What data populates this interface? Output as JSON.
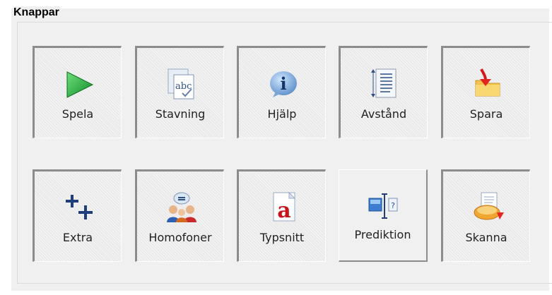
{
  "group": {
    "title": "Knappar"
  },
  "buttons": [
    {
      "label": "Spela",
      "icon": "play-icon"
    },
    {
      "label": "Stavning",
      "icon": "spelling-icon"
    },
    {
      "label": "Hjälp",
      "icon": "info-icon"
    },
    {
      "label": "Avstånd",
      "icon": "spacing-icon"
    },
    {
      "label": "Spara",
      "icon": "save-folder-icon"
    },
    {
      "label": "Extra",
      "icon": "plus-plus-icon"
    },
    {
      "label": "Homofoner",
      "icon": "people-chat-icon"
    },
    {
      "label": "Typsnitt",
      "icon": "font-icon"
    },
    {
      "label": "Prediktion",
      "icon": "prediction-icon"
    },
    {
      "label": "Skanna",
      "icon": "scan-icon"
    }
  ]
}
